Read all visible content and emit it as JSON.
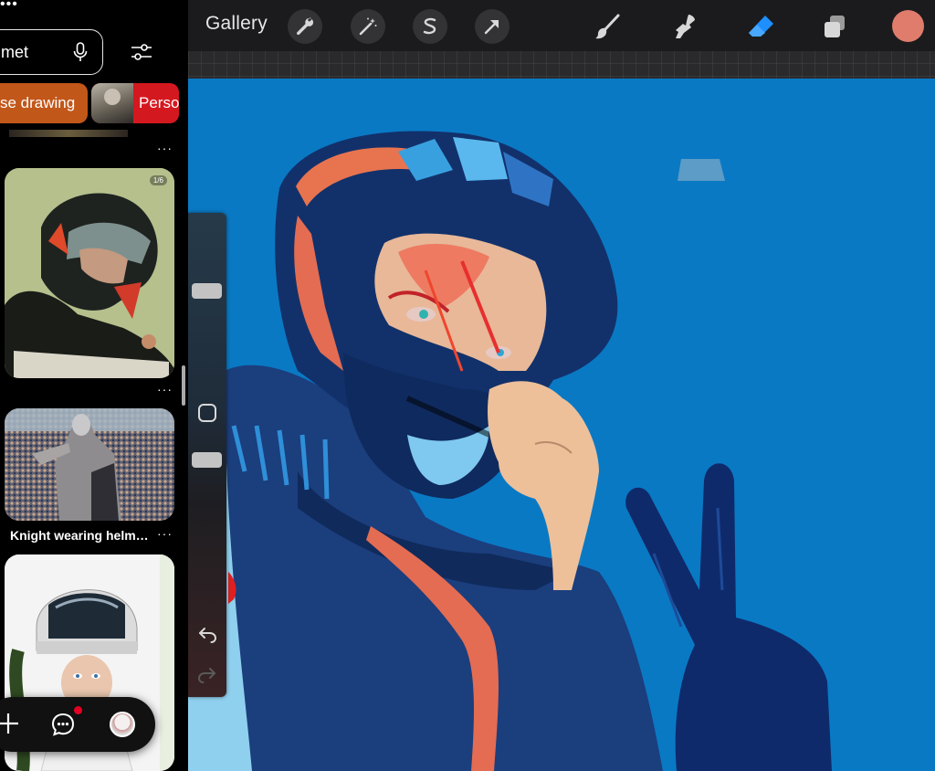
{
  "left_app": {
    "search": {
      "value": "met"
    },
    "chips": [
      {
        "label": "se drawing"
      },
      {
        "label": "Perso"
      }
    ],
    "pins": [
      {
        "badge": "1/6",
        "subject": "Person in motorcycle helmet"
      },
      {
        "label": "Knight wearing helm…"
      },
      {
        "subject": "Woman with astronaut helmet"
      }
    ],
    "more_glyph": "···",
    "bottom_nav": {
      "has_notification": true
    }
  },
  "procreate": {
    "gallery_label": "Gallery",
    "tools_left": [
      "wrench-icon",
      "magic-wand-icon",
      "selection-s-icon",
      "transform-arrow-icon"
    ],
    "tools_right": [
      "brush-icon",
      "smudge-icon",
      "eraser-icon",
      "layers-icon"
    ],
    "active_tool": "eraser",
    "current_color": "#e07c6c",
    "canvas_background": "#0a79c4",
    "sidebar": {
      "brush_size_level": 0.3,
      "opacity_level": 0.1
    }
  }
}
